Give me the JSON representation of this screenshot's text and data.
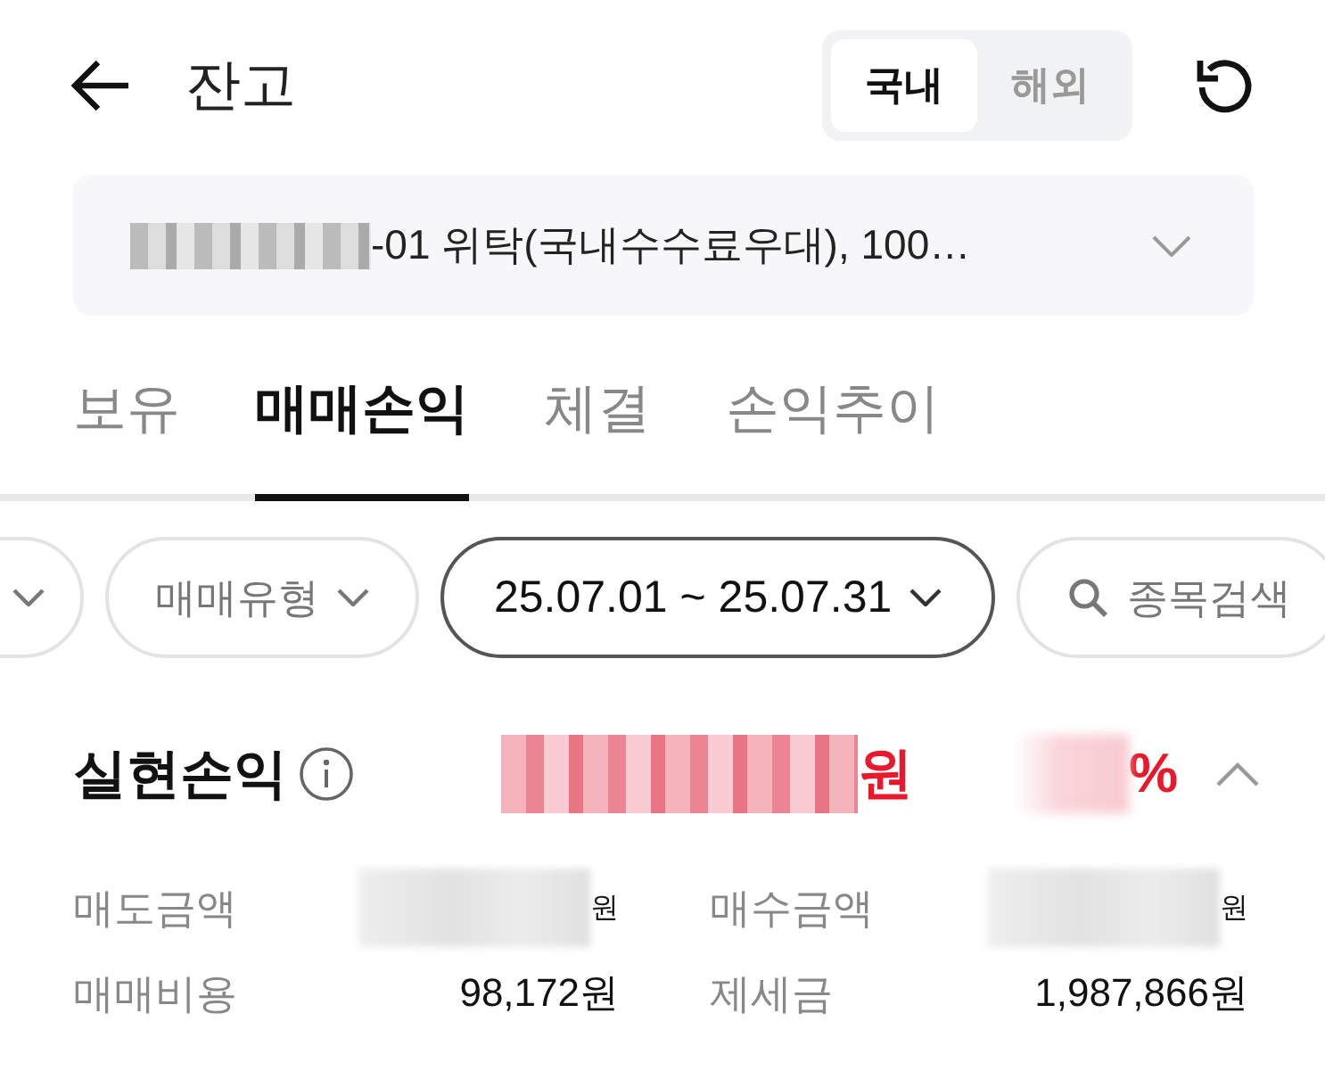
{
  "header": {
    "title": "잔고",
    "market_tabs": [
      {
        "label": "국내",
        "selected": true
      },
      {
        "label": "해외",
        "selected": false
      }
    ]
  },
  "account": {
    "masked": true,
    "text": "-01 위탁(국내수수료우대), 100…"
  },
  "tabs": [
    {
      "label": "보유",
      "selected": false
    },
    {
      "label": "매매손익",
      "selected": true
    },
    {
      "label": "체결",
      "selected": false
    },
    {
      "label": "손익추이",
      "selected": false
    }
  ],
  "filters": [
    {
      "kind": "dropdown",
      "selected": false
    },
    {
      "kind": "dropdown",
      "label": "매매유형",
      "selected": false
    },
    {
      "kind": "dropdown",
      "label": "25.07.01 ~ 25.07.31",
      "selected": true
    },
    {
      "kind": "search",
      "label": "종목검색",
      "selected": false
    }
  ],
  "summary": {
    "label": "실현손익",
    "amount_masked": true,
    "amount_unit": "원",
    "rate_masked": true,
    "rate_unit": "%",
    "expanded": true
  },
  "details": [
    {
      "label": "매도금액",
      "masked": true,
      "value": "원"
    },
    {
      "label": "매수금액",
      "masked": true,
      "value": "원"
    },
    {
      "label": "매매비용",
      "masked": false,
      "value": "98,172원"
    },
    {
      "label": "제세금",
      "masked": false,
      "value": "1,987,866원"
    }
  ]
}
